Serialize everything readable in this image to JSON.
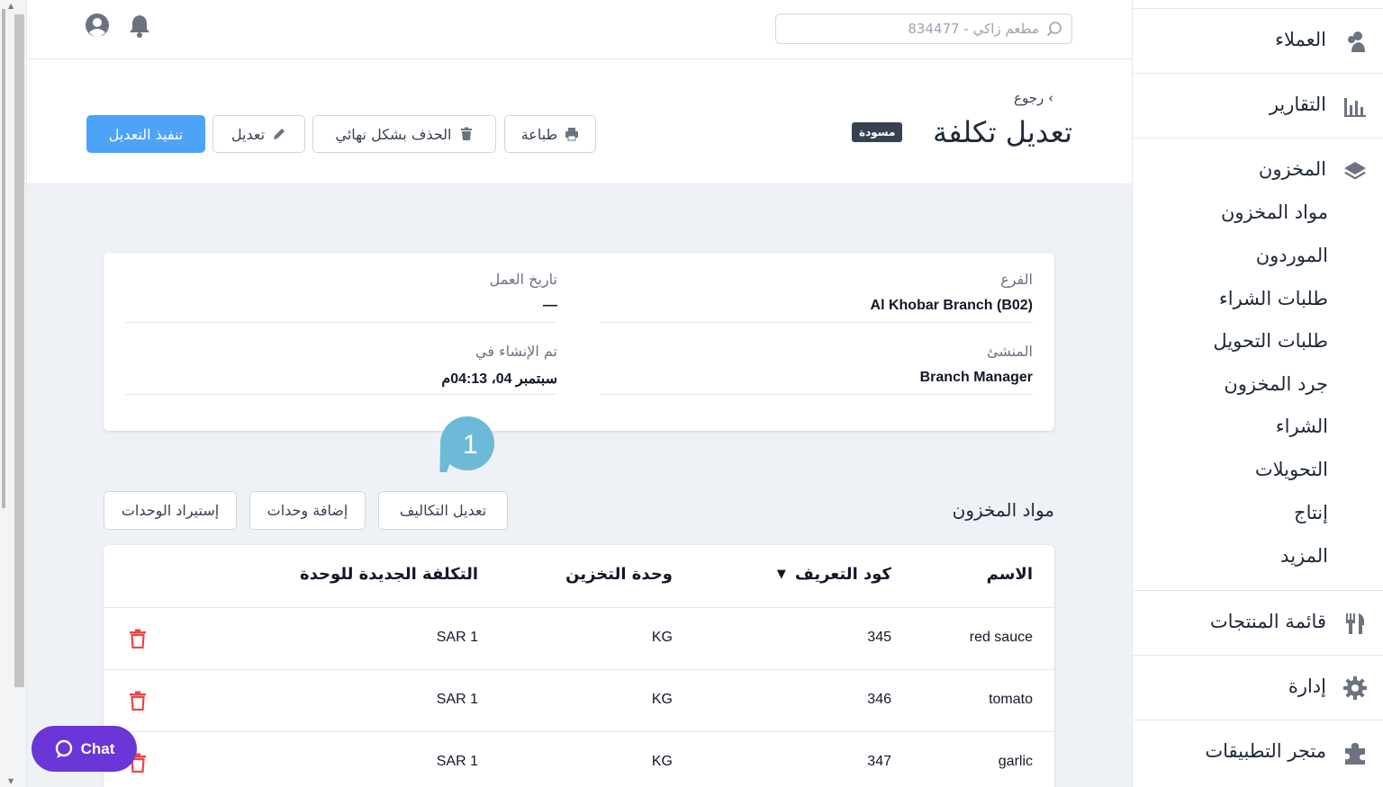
{
  "search": {
    "placeholder": "مطعم زاكي - 834477"
  },
  "header": {
    "back_label": "رجوع",
    "title": "تعديل تكلفة",
    "status_badge": "مسودة",
    "buttons": {
      "print": "طباعة",
      "delete_permanently": "الحذف بشكل نهائي",
      "edit": "تعديل",
      "apply": "تنفيذ التعديل"
    }
  },
  "details": {
    "branch_label": "الفرع",
    "branch_value": "Al Khobar Branch (B02)",
    "business_date_label": "تاريخ العمل",
    "business_date_value": "—",
    "creator_label": "المنشئ",
    "creator_value": "Branch Manager",
    "created_at_label": "تم الإنشاء في",
    "created_at_value": "سبتمبر 04، 04:13م"
  },
  "items_section": {
    "title": "مواد المخزون",
    "buttons": {
      "edit_costs": "تعديل التكاليف",
      "add_units": "إضافة وحدات",
      "import_units": "إستيراد الوحدات"
    },
    "tooltip_number": "1"
  },
  "table": {
    "columns": {
      "name": "الاسم",
      "sku": "كود التعريف",
      "storage_unit": "وحدة التخزين",
      "new_cost": "التكلفة الجديدة للوحدة"
    },
    "rows": [
      {
        "name": "red sauce",
        "sku": "345",
        "unit": "KG",
        "cost": "SAR 1"
      },
      {
        "name": "tomato",
        "sku": "346",
        "unit": "KG",
        "cost": "SAR 1"
      },
      {
        "name": "garlic",
        "sku": "347",
        "unit": "KG",
        "cost": "SAR 1"
      }
    ]
  },
  "sidebar": {
    "customers": "العملاء",
    "reports": "التقارير",
    "inventory": "المخزون",
    "inventory_sub": [
      "مواد المخزون",
      "الموردون",
      "طلبات الشراء",
      "طلبات التحويل",
      "جرد المخزون",
      "الشراء",
      "التحويلات",
      "إنتاج",
      "المزيد"
    ],
    "menu": "قائمة المنتجات",
    "manage": "إدارة",
    "marketplace": "متجر التطبيقات"
  },
  "chat": {
    "label": "Chat"
  },
  "colors": {
    "primary": "#4da3f7",
    "chat": "#6b35d8",
    "delete": "#ef4444",
    "tooltip": "#6cbad8"
  }
}
